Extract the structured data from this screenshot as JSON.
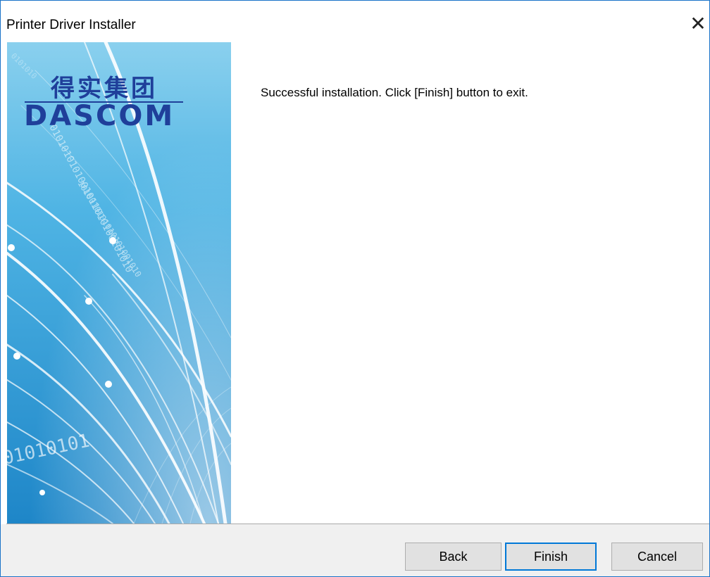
{
  "window": {
    "title": "Printer Driver Installer",
    "close_glyph": "✕"
  },
  "banner": {
    "logo_cn": "得实集团",
    "logo_en": "DASCOM",
    "binary_text": "01010101",
    "colors": {
      "top": "#7cc8ea",
      "bottom": "#1e88c9",
      "logo": "#1f3f9a"
    }
  },
  "main": {
    "message": "Successful installation. Click [Finish] button to exit."
  },
  "buttons": {
    "back": "Back",
    "finish": "Finish",
    "cancel": "Cancel"
  },
  "colors": {
    "accent": "#0078d7",
    "window_border": "#1a73c8",
    "footer_bg": "#f0f0f0"
  }
}
